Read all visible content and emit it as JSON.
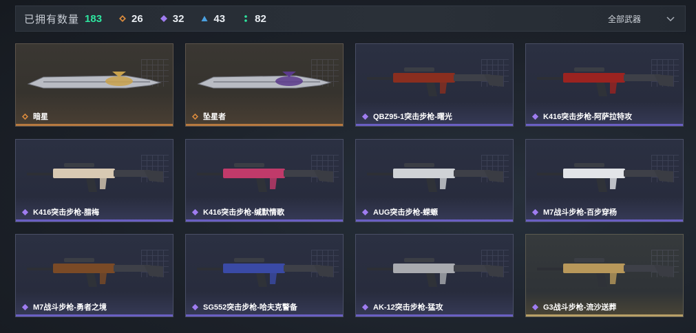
{
  "header": {
    "owned_label": "已拥有数量",
    "owned_count": "183",
    "stats": [
      {
        "icon": "orange-diamond-icon",
        "value": "26",
        "color": "#d98a3d"
      },
      {
        "icon": "purple-diamond-icon",
        "value": "32",
        "color": "#9f7cf0"
      },
      {
        "icon": "blue-triangle-icon",
        "value": "43",
        "color": "#4aa0e0"
      },
      {
        "icon": "green-dots-icon",
        "value": "82",
        "color": "#2ee6a0"
      }
    ],
    "filter": {
      "label": "全部武器"
    }
  },
  "weapons": [
    {
      "name": "暗星",
      "rarity": "orange",
      "icon": "knife-icon"
    },
    {
      "name": "坠星者",
      "rarity": "orange",
      "icon": "knife-icon"
    },
    {
      "name": "QBZ95-1突击步枪-曙光",
      "rarity": "purple",
      "icon": "rifle-icon"
    },
    {
      "name": "K416突击步枪-阿萨拉特攻",
      "rarity": "purple",
      "icon": "rifle-icon"
    },
    {
      "name": "K416突击步枪-腊梅",
      "rarity": "purple",
      "icon": "rifle-icon"
    },
    {
      "name": "K416突击步枪-缄默情歌",
      "rarity": "purple",
      "icon": "rifle-icon"
    },
    {
      "name": "AUG突击步枪-蝾螈",
      "rarity": "purple",
      "icon": "rifle-icon"
    },
    {
      "name": "M7战斗步枪-百步穿杨",
      "rarity": "purple",
      "icon": "rifle-icon"
    },
    {
      "name": "M7战斗步枪-勇者之境",
      "rarity": "purple",
      "icon": "rifle-icon"
    },
    {
      "name": "SG552突击步枪-哈夫克警备",
      "rarity": "purple",
      "icon": "rifle-icon"
    },
    {
      "name": "AK-12突击步枪-猛攻",
      "rarity": "purple",
      "icon": "rifle-icon"
    },
    {
      "name": "G3战斗步枪-流沙送葬",
      "rarity": "purple",
      "icon": "rifle-icon"
    }
  ]
}
